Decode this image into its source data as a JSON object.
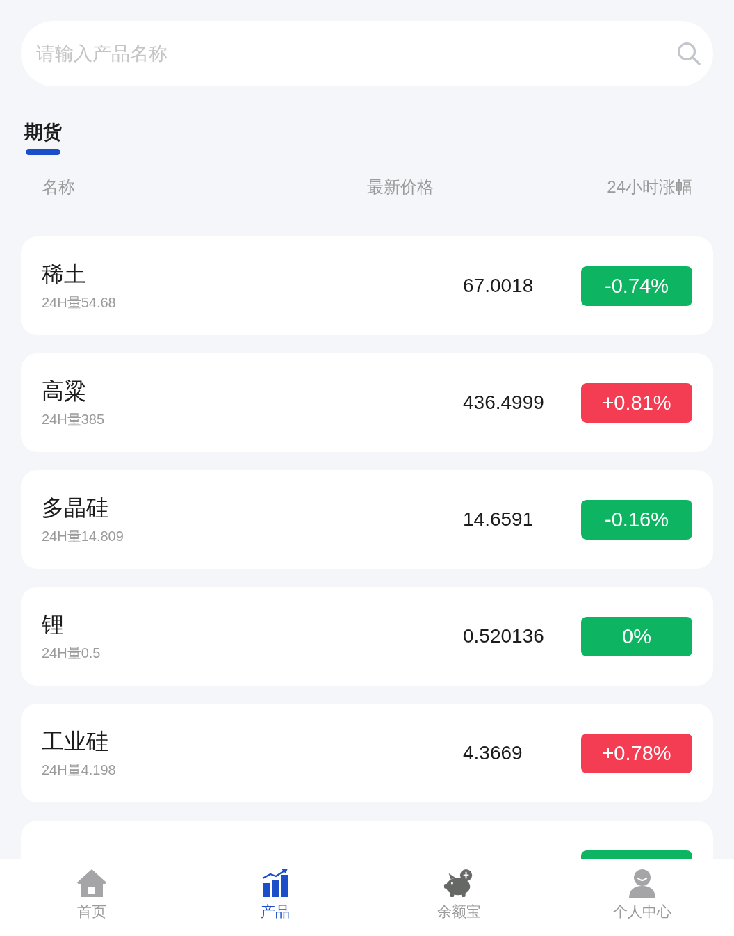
{
  "search": {
    "placeholder": "请输入产品名称"
  },
  "tabs": [
    {
      "label": "期货",
      "selected": true
    }
  ],
  "table": {
    "columns": [
      "名称",
      "最新价格",
      "24小时涨幅"
    ],
    "rows": [
      {
        "name": "稀土",
        "volume": "24H量54.68",
        "price": "67.0018",
        "change": "-0.74%",
        "color": "#0db562"
      },
      {
        "name": "高粱",
        "volume": "24H量385",
        "price": "436.4999",
        "change": "+0.81%",
        "color": "#f43c52"
      },
      {
        "name": "多晶硅",
        "volume": "24H量14.809",
        "price": "14.6591",
        "change": "-0.16%",
        "color": "#0db562"
      },
      {
        "name": "锂",
        "volume": "24H量0.5",
        "price": "0.520136",
        "change": "0%",
        "color": "#0db562"
      },
      {
        "name": "工业硅",
        "volume": "24H量4.198",
        "price": "4.3669",
        "change": "+0.78%",
        "color": "#f43c52"
      },
      {
        "color": "#0db562"
      }
    ]
  },
  "nav": [
    {
      "kind": "home",
      "label": "首页",
      "selected": false
    },
    {
      "kind": "chart",
      "label": "产品",
      "selected": true
    },
    {
      "kind": "piggy",
      "label": "余额宝",
      "selected": false
    },
    {
      "kind": "person",
      "label": "个人中心",
      "selected": false
    }
  ]
}
